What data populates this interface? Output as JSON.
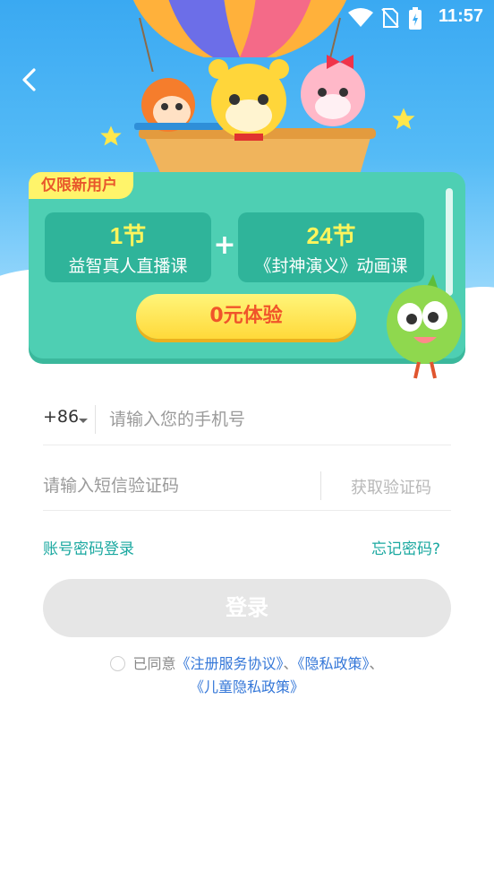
{
  "status_bar": {
    "time": "11:57"
  },
  "promo": {
    "tag": "仅限新用户",
    "offers": [
      {
        "count": "1节",
        "desc": "益智真人直播课"
      },
      {
        "count": "24节",
        "desc": "《封神演义》动画课"
      }
    ],
    "plus": "+",
    "free_button": "0元体验"
  },
  "form": {
    "country_code": "+86",
    "phone_placeholder": "请输入您的手机号",
    "code_placeholder": "请输入短信验证码",
    "get_code": "获取验证码",
    "account_login": "账号密码登录",
    "forgot_password": "忘记密码?",
    "login_button": "登录"
  },
  "agreement": {
    "prefix": "已同意",
    "service": "《注册服务协议》",
    "sep1": "、",
    "privacy": "《隐私政策》",
    "sep2": "、",
    "child_privacy": "《儿童隐私政策》"
  },
  "colors": {
    "accent": "#1aa8a0",
    "link": "#3477d8",
    "promo_green": "#4ecfb3",
    "button_yellow": "#ffd93a"
  },
  "icons": [
    "back-arrow-icon",
    "wifi-icon",
    "no-sim-icon",
    "battery-icon",
    "caret-down-icon",
    "radio-icon"
  ]
}
